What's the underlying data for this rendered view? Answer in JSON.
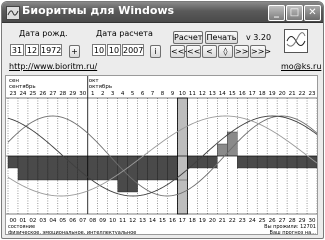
{
  "window": {
    "title": "Биоритмы для Windows"
  },
  "titlebar": {
    "minimize_label": "_",
    "maximize_label": "□",
    "close_label": "✕"
  },
  "birth": {
    "label": "Дата рожд.",
    "day": "31",
    "month": "12",
    "year": "1972"
  },
  "calc": {
    "label": "Дата расчета",
    "day": "10",
    "month": "10",
    "year": "2007"
  },
  "buttons": {
    "plus": "+",
    "calculate": "Расчет",
    "print": "Печать",
    "info": "i",
    "nav": [
      "<<<",
      "<<",
      "<",
      "◊",
      ">>",
      ">>>"
    ]
  },
  "version": "v 3.20",
  "site_link": "http://www.bioritm.ru/",
  "email_link": "mo@ks.ru",
  "chart_data": {
    "type": "line",
    "month_labels": [
      {
        "top": "сен",
        "bottom": "сентябрь"
      },
      {
        "top": "окт",
        "bottom": "октябрь"
      }
    ],
    "top_days": [
      "23",
      "24",
      "25",
      "26",
      "27",
      "28",
      "29",
      "30",
      "1",
      "2",
      "3",
      "4",
      "5",
      "6",
      "7",
      "8",
      "9",
      "10",
      "11",
      "12",
      "13",
      "14",
      "15",
      "16",
      "17",
      "18",
      "19",
      "20",
      "21",
      "22",
      "23"
    ],
    "bottom_days": [
      "00",
      "01",
      "02",
      "03",
      "04",
      "05",
      "06",
      "07",
      "08",
      "09",
      "10",
      "11",
      "12",
      "13",
      "14",
      "15",
      "16",
      "17",
      "18",
      "19",
      "20",
      "21",
      "22",
      "23",
      "24",
      "25",
      "26",
      "27",
      "28",
      "29",
      "30"
    ],
    "current_day_index": 17,
    "series": [
      {
        "period": 23,
        "color": "#6f6f6f"
      },
      {
        "period": 28,
        "color": "#3f3f3f"
      },
      {
        "period": 33,
        "color": "#9a9a9a"
      }
    ],
    "summary": [
      -1,
      -2,
      -2,
      -2,
      -2,
      -2,
      -2,
      -2,
      -2,
      -2,
      -2,
      -3,
      -3,
      -2,
      -2,
      -2,
      -2,
      -2,
      -1,
      -1,
      -1,
      1,
      2,
      -1,
      -1,
      -1,
      -1,
      -1,
      -1,
      -1,
      -1
    ],
    "bottom_left_lines": [
      "состояние",
      "физическое, эмоциональное, интеллектуальное"
    ],
    "bottom_right_lines": [
      "Вы прожили: 12701",
      "Ваш прогноз на..."
    ]
  },
  "colors": {
    "title_bar": "#5a5a5a",
    "summary_bar": "#4a4a4a",
    "today_bar": "#bdbdbd"
  }
}
